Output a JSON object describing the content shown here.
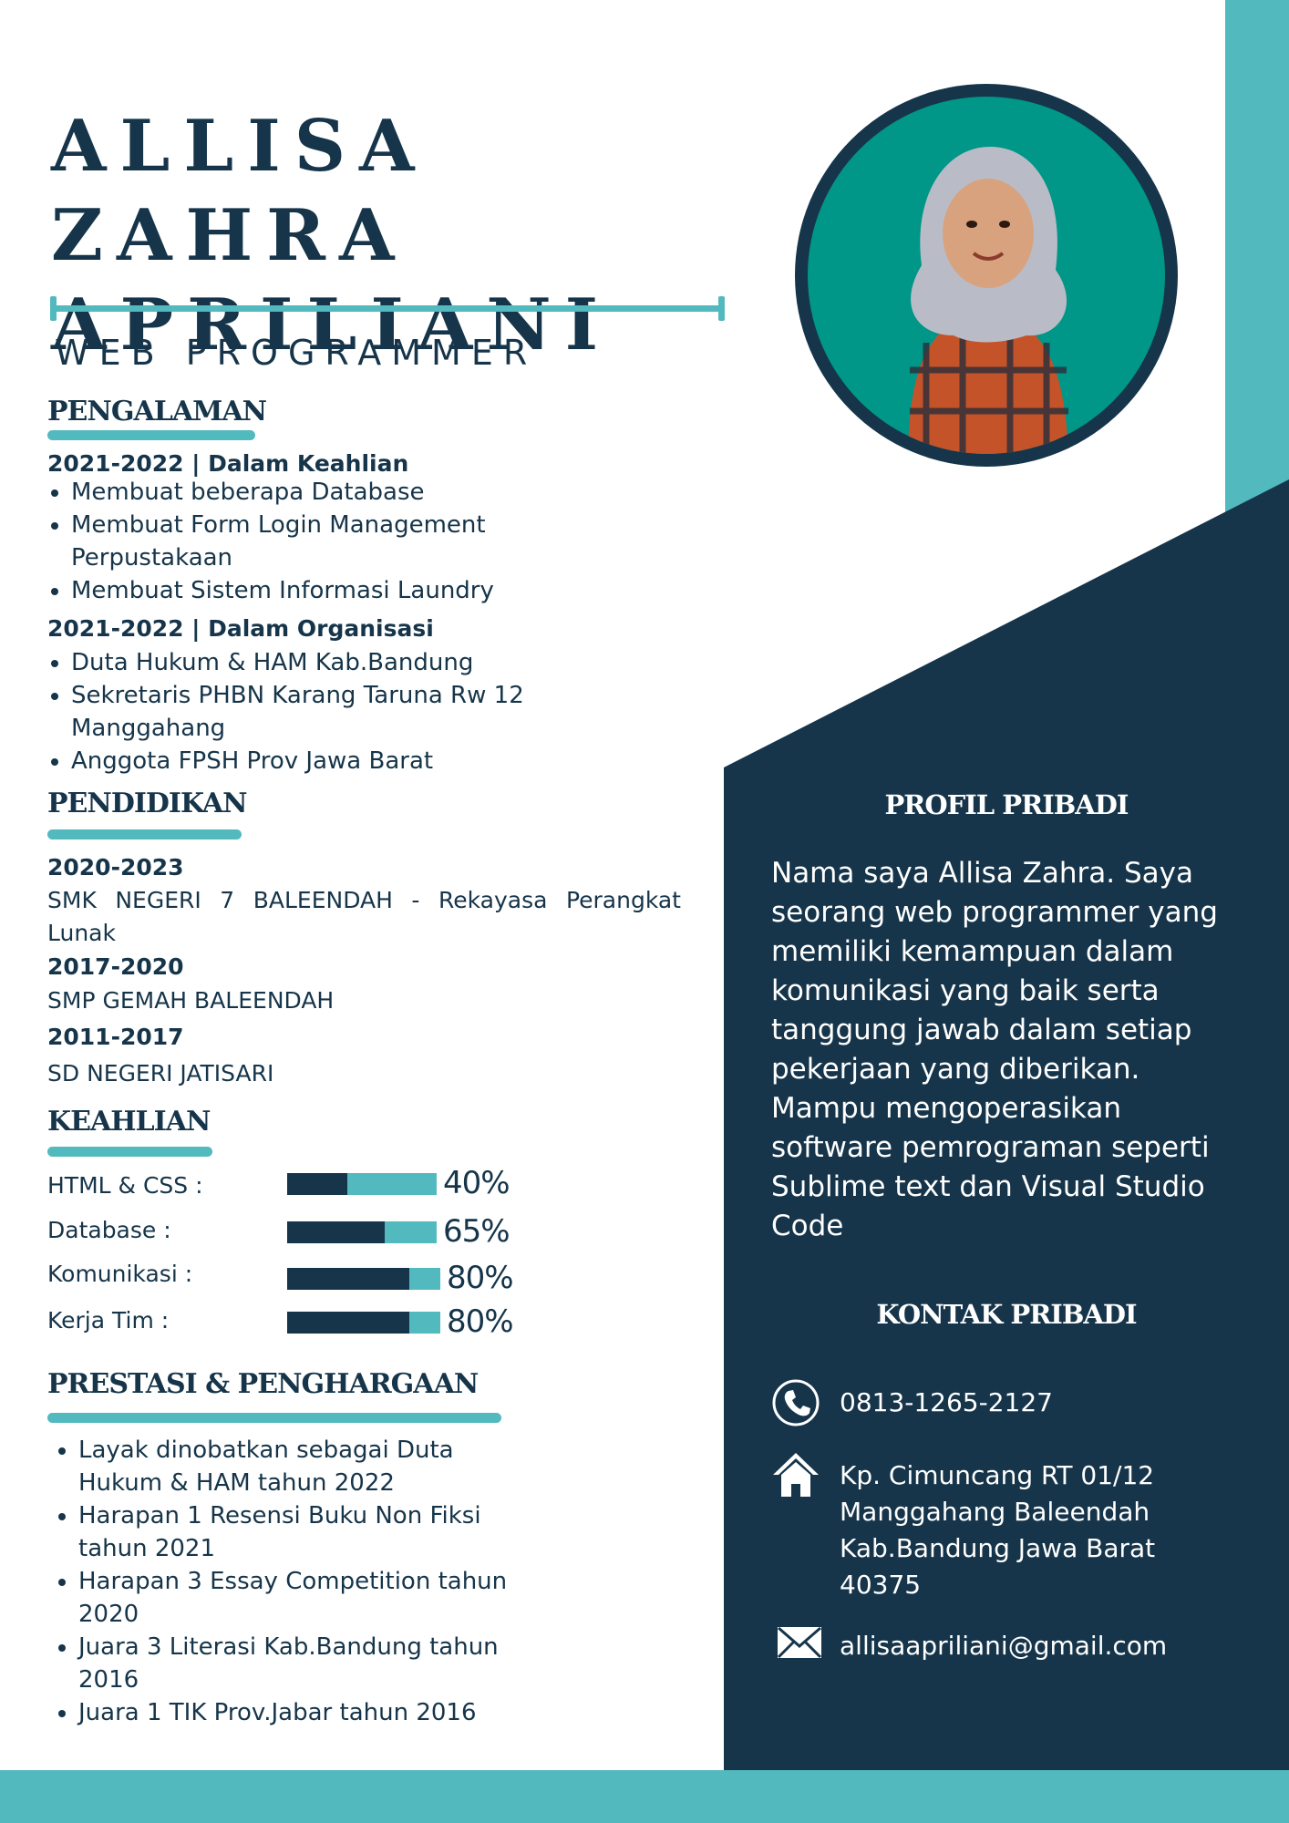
{
  "colors": {
    "navy": "#16354a",
    "teal": "#52b9bf",
    "photo_bg": "#009688",
    "white": "#ffffff"
  },
  "header": {
    "name_line1": "ALLISA ZAHRA",
    "name_line2": "APRILIANI",
    "job_title": "WEB PROGRAMMER"
  },
  "experience": {
    "title": "PENGALAMAN",
    "groups": [
      {
        "heading": "2021-2022 | Dalam Keahlian",
        "items": [
          "Membuat beberapa Database",
          "Membuat Form Login Management Perpustakaan",
          "Membuat Sistem Informasi Laundry"
        ]
      },
      {
        "heading": "2021-2022 | Dalam Organisasi",
        "items": [
          "Duta Hukum & HAM Kab.Bandung",
          "Sekretaris PHBN Karang Taruna Rw 12 Manggahang",
          "Anggota FPSH Prov Jawa Barat"
        ]
      }
    ]
  },
  "education": {
    "title": "PENDIDIKAN",
    "entries": [
      {
        "years": "2020-2023",
        "school": "SMK NEGERI 7 BALEENDAH - Rekayasa Perangkat Lunak"
      },
      {
        "years": "2017-2020",
        "school": "SMP GEMAH BALEENDAH"
      },
      {
        "years": "2011-2017",
        "school": "SD NEGERI JATISARI"
      }
    ]
  },
  "skills": {
    "title": "KEAHLIAN",
    "items": [
      {
        "label": "HTML & CSS :",
        "value": 0.4,
        "percent": "40%"
      },
      {
        "label": "Database :",
        "value": 0.65,
        "percent": "65%"
      },
      {
        "label": "Komunikasi :",
        "value": 0.8,
        "percent": "80%"
      },
      {
        "label": "Kerja Tim :",
        "value": 0.8,
        "percent": "80%"
      }
    ]
  },
  "achievements": {
    "title": "PRESTASI & PENGHARGAAN",
    "items": [
      "Layak dinobatkan sebagai Duta Hukum & HAM tahun 2022",
      "Harapan 1 Resensi Buku Non Fiksi tahun 2021",
      "Harapan 3 Essay Competition tahun 2020",
      "Juara 3 Literasi Kab.Bandung tahun 2016",
      "Juara 1 TIK Prov.Jabar tahun 2016"
    ]
  },
  "profile": {
    "title": "PROFIL PRIBADI",
    "text": "Nama saya Allisa Zahra. Saya seorang web programmer yang memiliki kemampuan dalam komunikasi yang baik serta tanggung jawab dalam setiap pekerjaan yang diberikan. Mampu mengoperasikan software pemrograman seperti Sublime text dan Visual Studio Code"
  },
  "contact": {
    "title": "KONTAK PRIBADI",
    "phone_icon": "phone-icon",
    "phone": "0813-1265-2127",
    "address_icon": "home-icon",
    "address_lines": [
      "Kp. Cimuncang RT 01/12",
      "Manggahang Baleendah",
      "Kab.Bandung Jawa Barat",
      "40375"
    ],
    "email_icon": "mail-icon",
    "email": "allisaapriliani@gmail.com"
  }
}
